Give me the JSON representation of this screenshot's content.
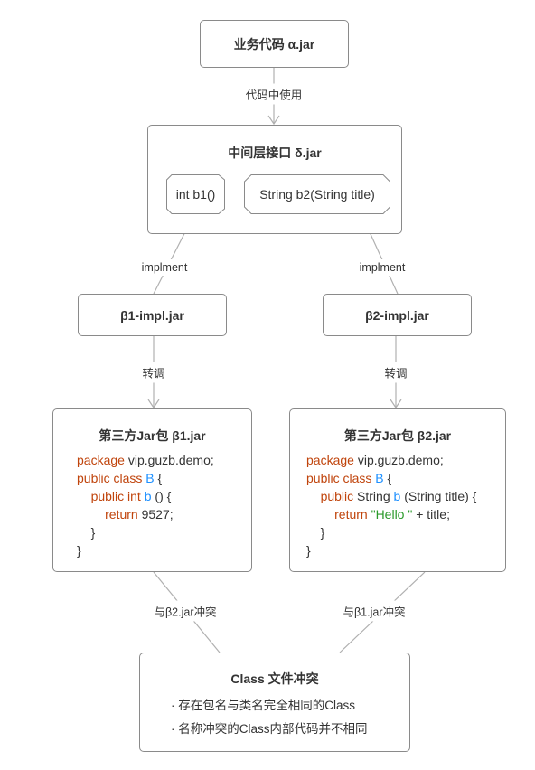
{
  "nodes": {
    "alpha": {
      "title": "业务代码 α.jar"
    },
    "delta": {
      "title": "中间层接口 δ.jar",
      "methods": [
        "int b1()",
        "String b2(String title)"
      ]
    },
    "beta1_impl": {
      "title": "β1-impl.jar"
    },
    "beta2_impl": {
      "title": "β2-impl.jar"
    },
    "beta1": {
      "title": "第三方Jar包 β1.jar",
      "code": {
        "l1_kw": "package",
        "l1": " vip.guzb.demo;",
        "l2_kw": "public class",
        "l2_id": "B",
        "l2": " {",
        "l3_kw": "public int",
        "l3_id": "b",
        "l3": " () {",
        "l4_kw": "return",
        "l4": " 9527;",
        "l5": "}",
        "l6": "}"
      }
    },
    "beta2": {
      "title": "第三方Jar包 β2.jar",
      "code": {
        "l1_kw": "package",
        "l1": " vip.guzb.demo;",
        "l2_kw": "public class",
        "l2_id": "B",
        "l2": " {",
        "l3_kw": "public",
        "l3_a": " String ",
        "l3_id": "b",
        "l3": " (String title) {",
        "l4_kw": "return",
        "l4_str": "\"Hello \"",
        "l4": " + title;",
        "l5": "}",
        "l6": "}"
      }
    },
    "conflict": {
      "title": "Class 文件冲突",
      "bullets": [
        "· 存在包名与类名完全相同的Class",
        "· 名称冲突的Class内部代码并不相同"
      ]
    }
  },
  "edges": {
    "use": "代码中使用",
    "impl1": "implment",
    "impl2": "implment",
    "call1": "转调",
    "call2": "转调",
    "conf1": "与β2.jar冲突",
    "conf2": "与β1.jar冲突"
  },
  "colors": {
    "keyword": "#c0440c",
    "identifier": "#1e90ff",
    "string": "#2a9a2a",
    "border": "#8a8a8a",
    "line": "#b0b0b0"
  }
}
